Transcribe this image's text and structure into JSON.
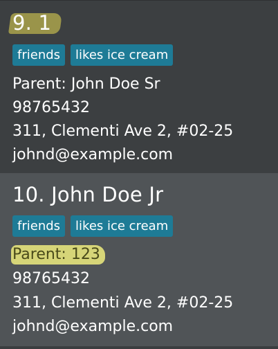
{
  "cards": [
    {
      "title": "9. 1",
      "tags": [
        "friends",
        "likes ice cream"
      ],
      "parent": "Parent: John Doe Sr",
      "phone": "98765432",
      "address": "311, Clementi Ave 2, #02-25",
      "email": "johnd@example.com"
    },
    {
      "title": "10. John Doe Jr",
      "tags": [
        "friends",
        "likes ice cream"
      ],
      "parent": "Parent: 123",
      "phone": "98765432",
      "address": "311, Clementi Ave 2, #02-25",
      "email": "johnd@example.com"
    }
  ],
  "colors": {
    "tag_background": "#1e7b96",
    "card_selected_background": "#505457",
    "card_background": "#3c3f41",
    "title_highlight": "#9a944a",
    "parent_highlight": "#d6d578"
  }
}
